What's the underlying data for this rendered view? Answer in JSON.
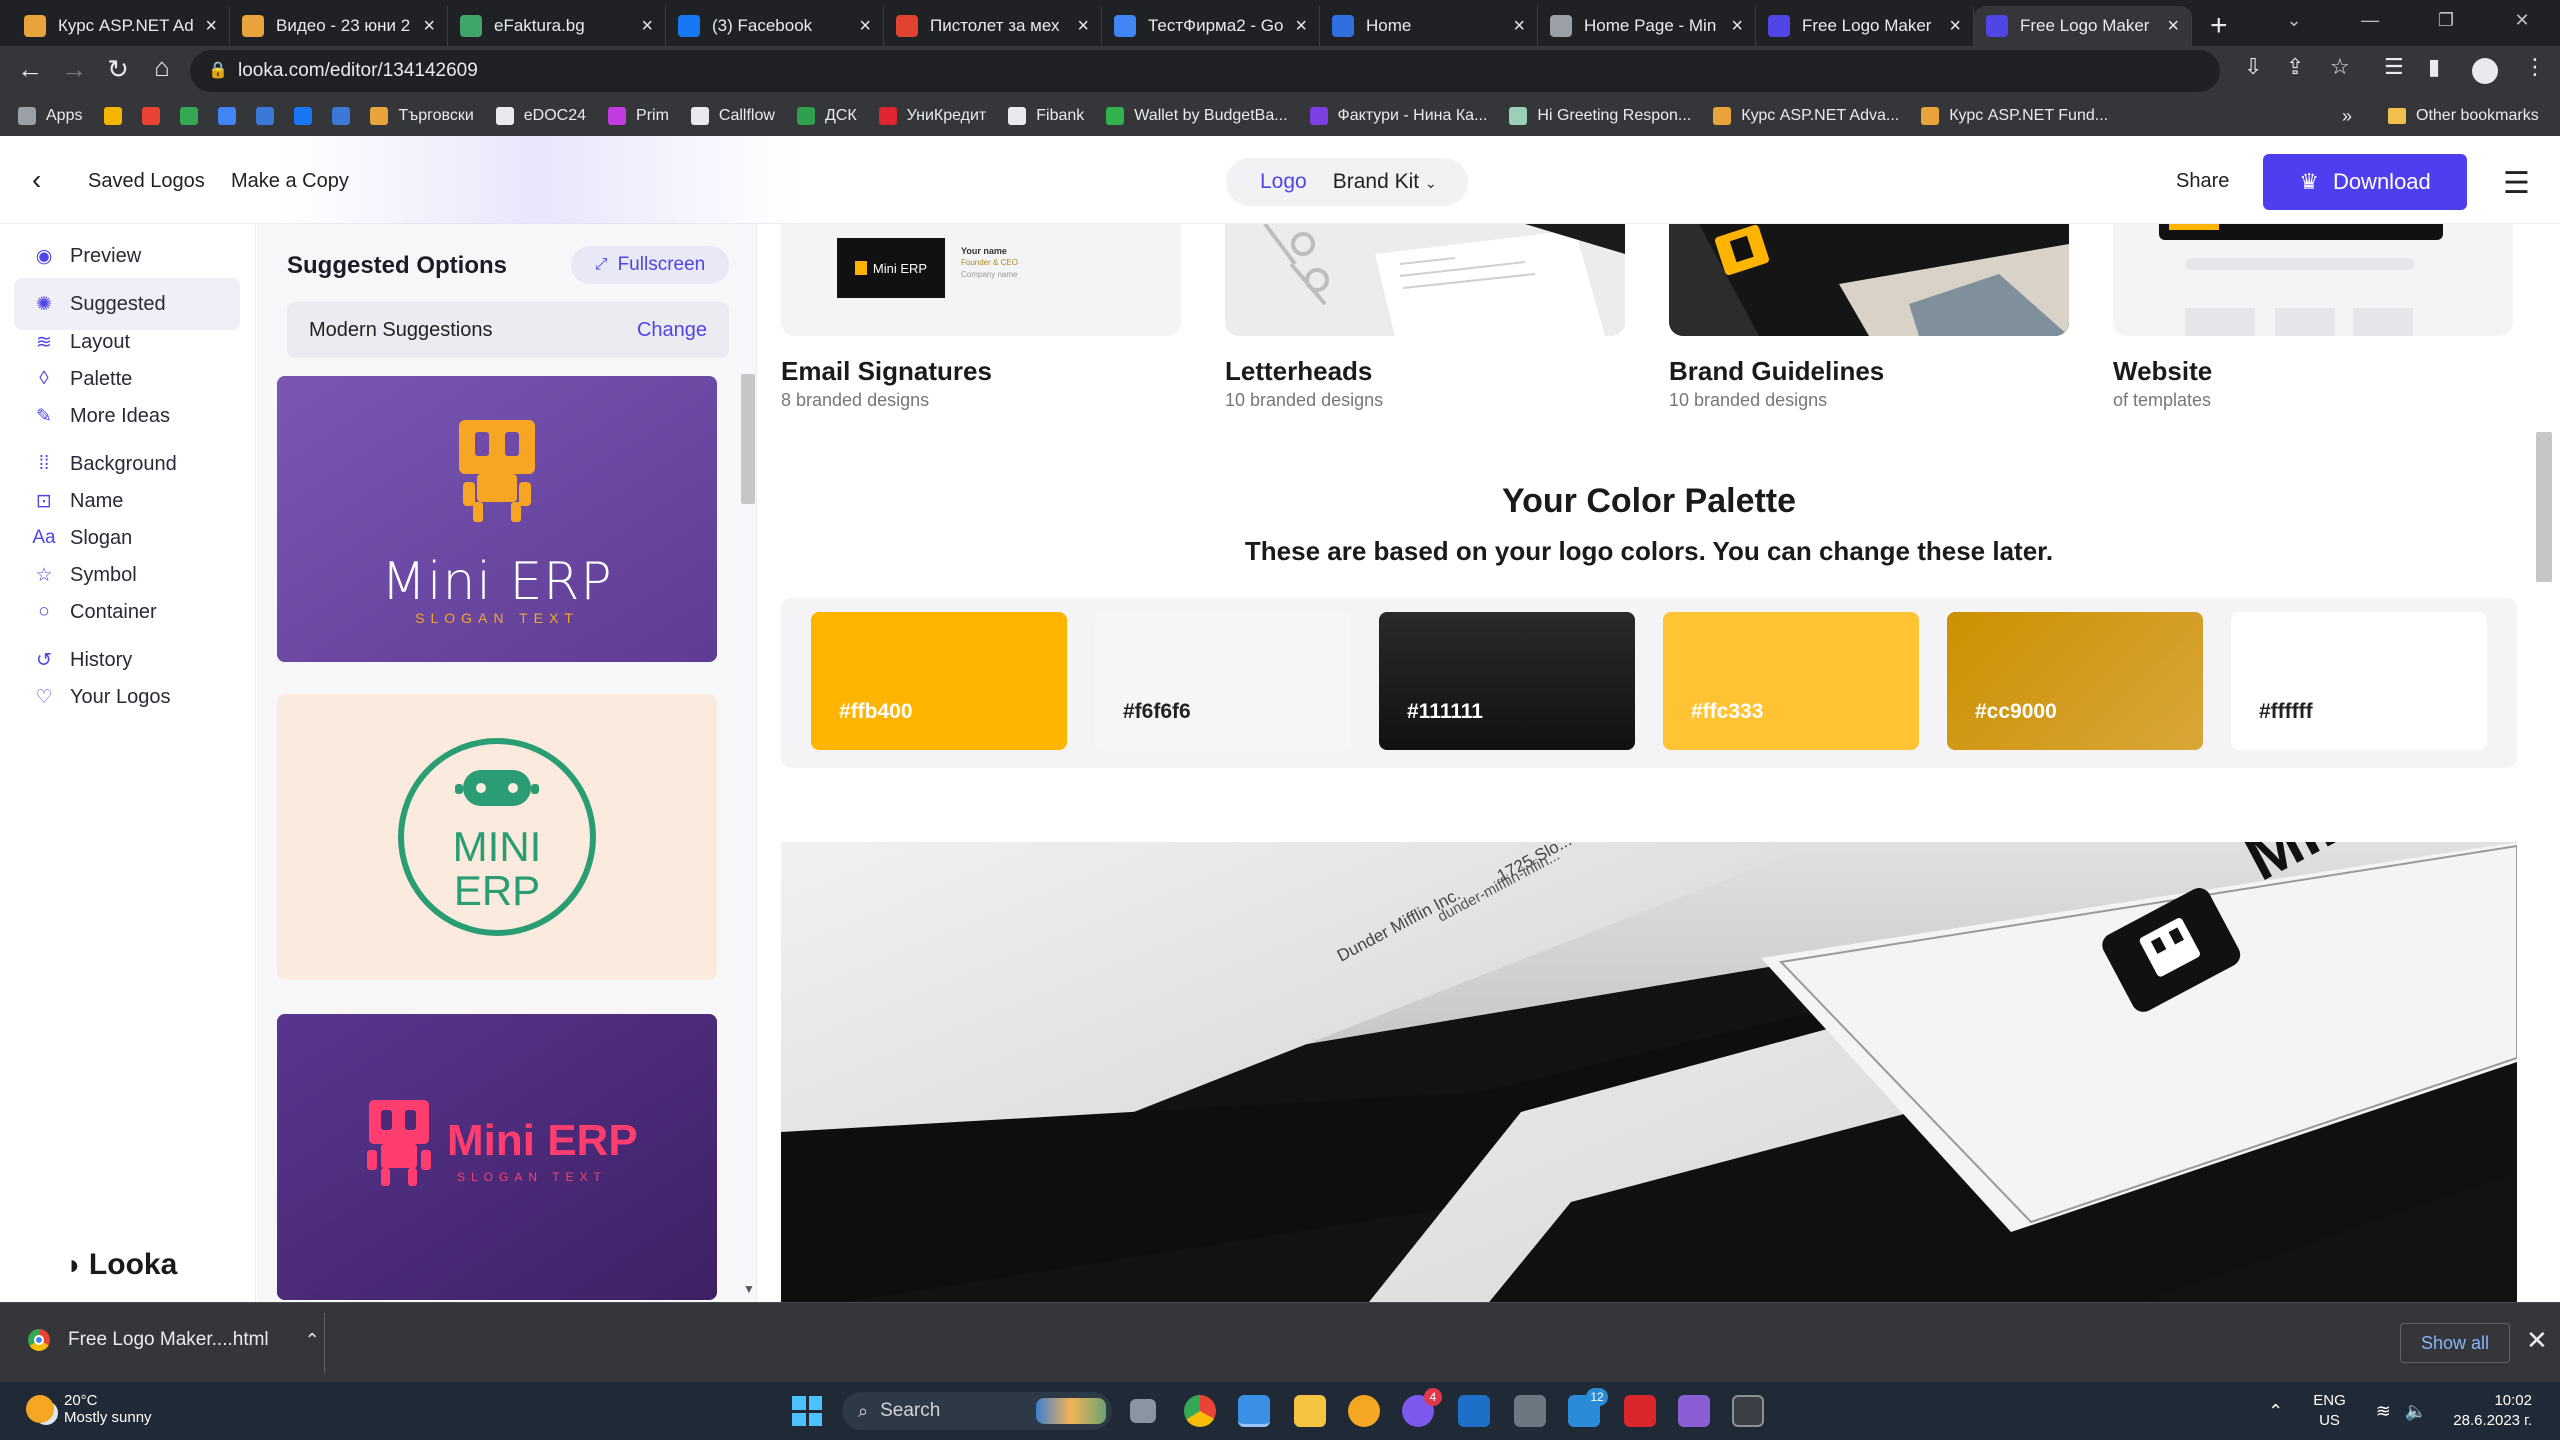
{
  "browser": {
    "tabs": [
      {
        "title": "Курс ASP.NET Ad",
        "color": "#e8a33d"
      },
      {
        "title": "Видео - 23 юни 2",
        "color": "#e8a33d"
      },
      {
        "title": "eFaktura.bg",
        "color": "#3fa56b"
      },
      {
        "title": "(3) Facebook",
        "color": "#1877f2"
      },
      {
        "title": "Пистолет за мех",
        "color": "#e0432f"
      },
      {
        "title": "ТестФирма2 - Go",
        "color": "#4285f4"
      },
      {
        "title": "Home",
        "color": "#2f6fe0"
      },
      {
        "title": "Home Page - Min",
        "color": "#9aa0a6"
      },
      {
        "title": "Free Logo Maker",
        "color": "#4f46e5"
      },
      {
        "title": "Free Logo Maker",
        "color": "#4f46e5",
        "active": true
      }
    ],
    "url": "looka.com/editor/134142609",
    "bookmarks": [
      {
        "label": "Apps",
        "color": "#9aa0a6"
      },
      {
        "label": "",
        "color": "#f4b400"
      },
      {
        "label": "",
        "color": "#ea4335"
      },
      {
        "label": "",
        "color": "#34a853"
      },
      {
        "label": "",
        "color": "#4285f4"
      },
      {
        "label": "",
        "color": "#3c78d8"
      },
      {
        "label": "",
        "color": "#1877f2"
      },
      {
        "label": "",
        "color": "#3c78d8"
      },
      {
        "label": "Търговски",
        "color": "#e8a33d"
      },
      {
        "label": "eDOC24",
        "color": "#e8eaed"
      },
      {
        "label": "Prim",
        "color": "#c33be0"
      },
      {
        "label": "Callflow",
        "color": "#e8eaed"
      },
      {
        "label": "ДСК",
        "color": "#2e9e4f"
      },
      {
        "label": "УниКредит",
        "color": "#e0272f"
      },
      {
        "label": "Fibank",
        "color": "#e8eaed"
      },
      {
        "label": "Wallet by BudgetBa...",
        "color": "#2fb34a"
      },
      {
        "label": "Фактури - Нина Ка...",
        "color": "#7b3fe4"
      },
      {
        "label": "Hi Greeting Respon...",
        "color": "#9bd0b7"
      },
      {
        "label": "Курс ASP.NET Adva...",
        "color": "#e8a33d"
      },
      {
        "label": "Курс ASP.NET Fund...",
        "color": "#e8a33d"
      }
    ],
    "bookmarks_more": "»",
    "other_bookmarks": "Other bookmarks"
  },
  "header": {
    "saved_logos": "Saved Logos",
    "make_copy": "Make a Copy",
    "tab_logo": "Logo",
    "tab_brandkit": "Brand Kit",
    "share": "Share",
    "download": "Download"
  },
  "nav": {
    "items": [
      {
        "label": "Preview",
        "icon": "eye-icon"
      },
      {
        "label": "Suggested",
        "icon": "sparkle-icon",
        "selected": true
      },
      {
        "label": "Layout",
        "icon": "layers-icon"
      },
      {
        "label": "Palette",
        "icon": "droplet-icon"
      },
      {
        "label": "More Ideas",
        "icon": "wand-icon"
      },
      {
        "label": "Background",
        "icon": "dotgrid-icon"
      },
      {
        "label": "Name",
        "icon": "text-box-icon"
      },
      {
        "label": "Slogan",
        "icon": "font-icon"
      },
      {
        "label": "Symbol",
        "icon": "star-icon"
      },
      {
        "label": "Container",
        "icon": "circle-icon"
      },
      {
        "label": "History",
        "icon": "history-icon"
      },
      {
        "label": "Your Logos",
        "icon": "heart-icon"
      }
    ],
    "brand": "Looka"
  },
  "suggestions": {
    "title": "Suggested Options",
    "fullscreen": "Fullscreen",
    "mode": "Modern Suggestions",
    "change": "Change",
    "cards": [
      {
        "name": "Mini ERP",
        "slogan": "SLOGAN TEXT",
        "bg": "#6f4aa8",
        "fg": "#f6a623"
      },
      {
        "name_line1": "MINI",
        "name_line2": "ERP",
        "bg": "#fbebde",
        "fg": "#2a9d74"
      },
      {
        "name": "Mini ERP",
        "slogan": "SLOGAN TEXT",
        "bg": "#4a2a78",
        "fg": "#ff3d6e"
      }
    ]
  },
  "brandkit": {
    "templates": [
      {
        "title": "Email Signatures",
        "sub": "8 branded designs"
      },
      {
        "title": "Letterheads",
        "sub": "10 branded designs"
      },
      {
        "title": "Brand Guidelines",
        "sub": "10 branded designs"
      },
      {
        "title": "Website",
        "sub": "of templates"
      }
    ],
    "email_preview": {
      "name": "Mini ERP",
      "line1": "Your name",
      "line2": "Founder & CEO",
      "line3": "Company name"
    },
    "palette_title": "Your Color Palette",
    "palette_sub": "These are based on your logo colors. You can change these later.",
    "swatches": [
      {
        "hex": "#ffb400",
        "label": "#ffb400",
        "text_color": "#ffffff"
      },
      {
        "hex": "#f6f6f6",
        "label": "#f6f6f6",
        "text_color": "#222222"
      },
      {
        "hex": "#111111",
        "label": "#111111",
        "text_color": "#ffffff"
      },
      {
        "hex": "#ffc333",
        "label": "#ffc333",
        "text_color": "#ffffff"
      },
      {
        "hex": "#cc9000",
        "label": "#cc9000",
        "text_color": "#ffffff"
      },
      {
        "hex": "#ffffff",
        "label": "#ffffff",
        "text_color": "#222222"
      }
    ],
    "mockup": {
      "company": "Dunder Mifflin Inc.",
      "address": "1725 Slo...",
      "web": "dunder-mifflin-infin...",
      "logo_text": "Mini"
    }
  },
  "downloads": {
    "file": "Free Logo Maker....html",
    "show_all": "Show all"
  },
  "taskbar": {
    "temp": "20°C",
    "weather": "Mostly sunny",
    "search": "Search",
    "lang1": "ENG",
    "lang2": "US",
    "time": "10:02",
    "date": "28.6.2023 г.",
    "badges": {
      "viber": "4",
      "mail": "12"
    }
  }
}
